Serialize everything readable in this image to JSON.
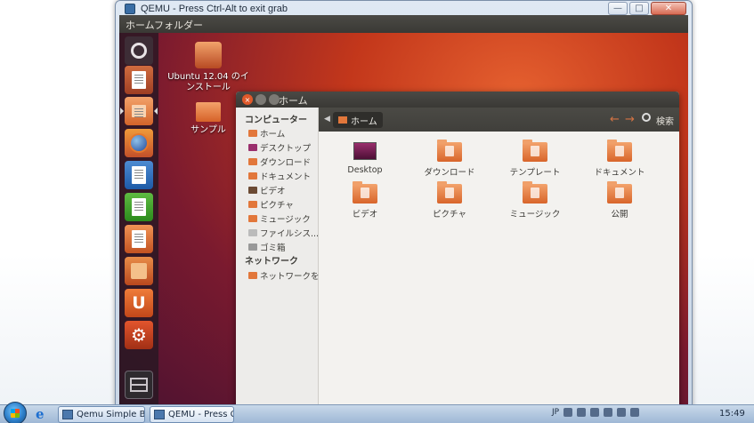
{
  "host": {
    "qemu_window_title": "QEMU - Press Ctrl-Alt to exit grab",
    "controls": {
      "minimize": "—",
      "maximize": "□",
      "close": "✕"
    }
  },
  "guest": {
    "topbar_title": "ホームフォルダー",
    "desktop_icons": [
      {
        "label": "Ubuntu 12.04 のインストール",
        "icon": "installer-icon"
      },
      {
        "label": "サンプル",
        "icon": "folder-link-icon"
      }
    ],
    "launcher_items": [
      {
        "name": "dash-home",
        "icon": "ubuntu-logo-icon"
      },
      {
        "name": "ubuntu-installer",
        "icon": "installer-icon"
      },
      {
        "name": "files",
        "icon": "folder-icon"
      },
      {
        "name": "firefox",
        "icon": "firefox-icon"
      },
      {
        "name": "libreoffice-writer",
        "icon": "writer-icon"
      },
      {
        "name": "libreoffice-calc",
        "icon": "calc-icon"
      },
      {
        "name": "libreoffice-impress",
        "icon": "impress-icon"
      },
      {
        "name": "software-center",
        "icon": "shopping-bag-icon"
      },
      {
        "name": "ubuntu-one",
        "icon": "ubuntu-one-icon",
        "glyph": "U"
      },
      {
        "name": "system-settings",
        "icon": "settings-icon",
        "glyph": "⚙"
      },
      {
        "name": "workspace-switcher",
        "icon": "workspace-icon"
      }
    ]
  },
  "nautilus": {
    "window_title": "ホーム",
    "sidebar": {
      "computer_header": "コンピューター",
      "computer_items": [
        "ホーム",
        "デスクトップ",
        "ダウンロード",
        "ドキュメント",
        "ビデオ",
        "ピクチャ",
        "ミュージック",
        "ファイルシス...",
        "ゴミ箱"
      ],
      "network_header": "ネットワーク",
      "network_items": [
        "ネットワークを..."
      ]
    },
    "toolbar": {
      "breadcrumb": "ホーム",
      "back": "←",
      "forward": "→",
      "search_label": "検索"
    },
    "files": [
      {
        "label": "Desktop",
        "type": "desktop"
      },
      {
        "label": "ダウンロード",
        "type": "folder"
      },
      {
        "label": "テンプレート",
        "type": "folder"
      },
      {
        "label": "ドキュメント",
        "type": "folder"
      },
      {
        "label": "ビデオ",
        "type": "folder"
      },
      {
        "label": "ピクチャ",
        "type": "folder"
      },
      {
        "label": "ミュージック",
        "type": "folder"
      },
      {
        "label": "公開",
        "type": "folder"
      }
    ]
  },
  "taskbar": {
    "buttons": [
      {
        "label": "Qemu Simple Boo..."
      },
      {
        "label": "QEMU - Press Ctrl..."
      }
    ],
    "tray_lang": "JP",
    "clock": "15:49"
  }
}
